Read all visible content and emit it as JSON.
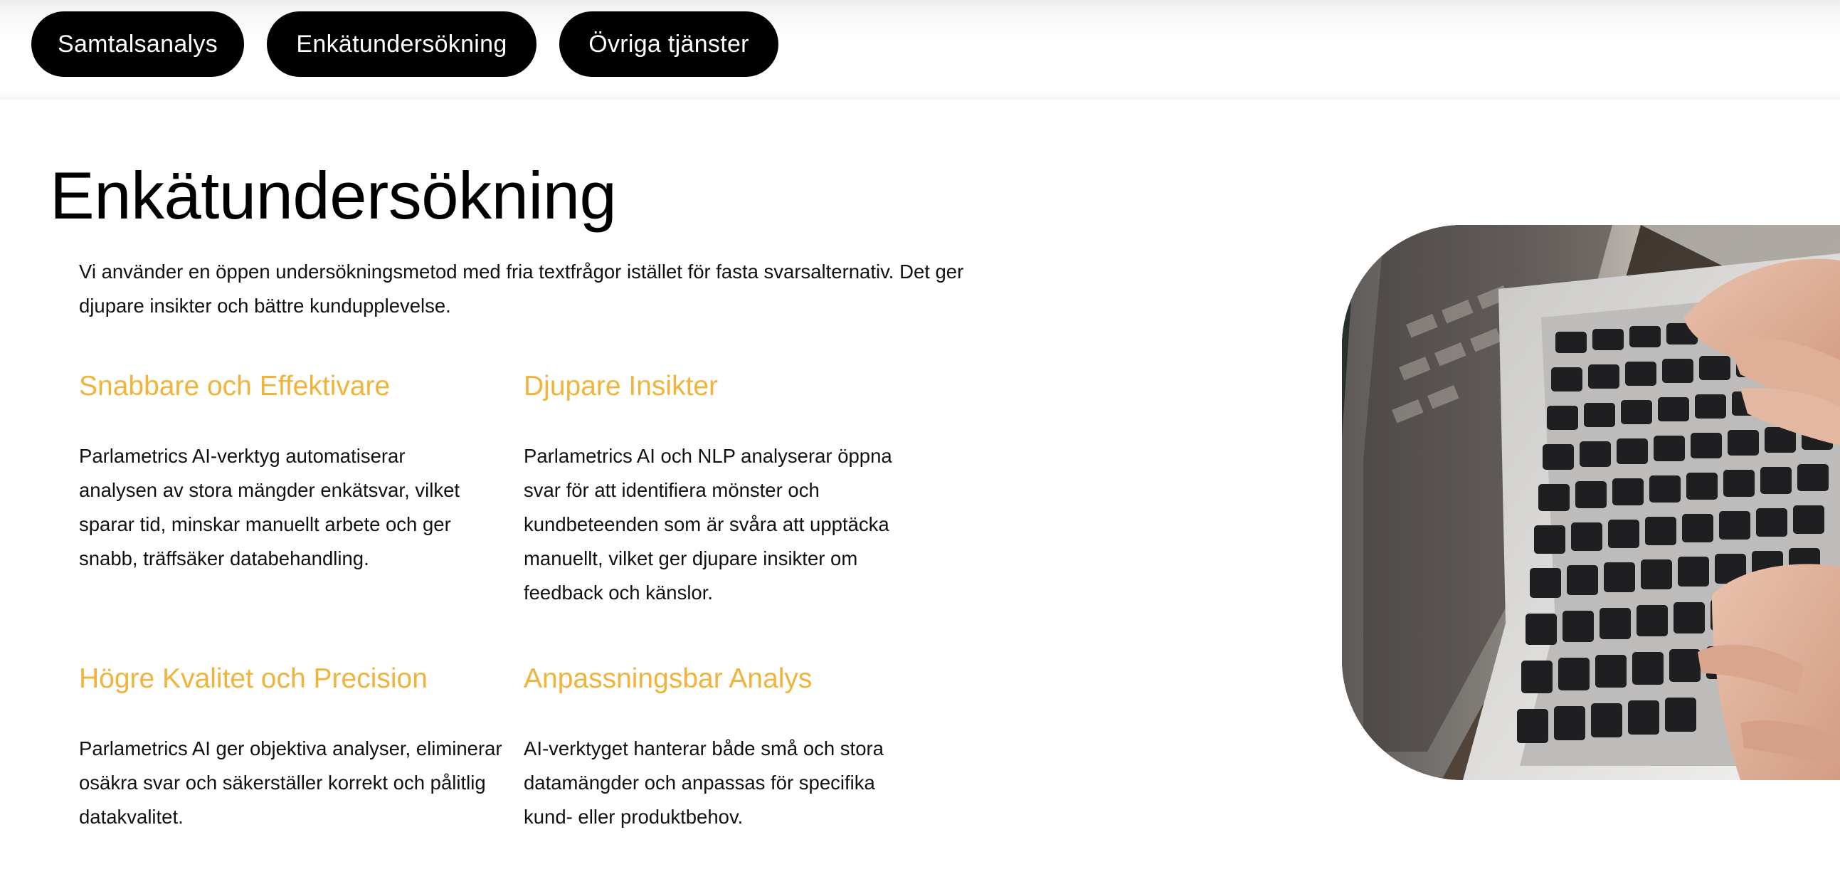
{
  "nav": {
    "items": [
      {
        "label": "Samtalsanalys"
      },
      {
        "label": "Enkätundersökning"
      },
      {
        "label": "Övriga tjänster"
      }
    ]
  },
  "page": {
    "title": "Enkätundersökning",
    "intro": "Vi använder en öppen undersökningsmetod med fria textfrågor istället för fasta svarsalternativ. Det ger djupare insikter och bättre kundupplevelse."
  },
  "features": [
    {
      "title": "Snabbare och Effektivare",
      "text": "Parlametrics AI-verktyg automatiserar analysen av stora mängder enkätsvar, vilket sparar tid, minskar manuellt arbete och ger snabb, träffsäker databehandling."
    },
    {
      "title": "Djupare Insikter",
      "text": "Parlametrics AI och NLP analyserar öppna svar för att identifiera mönster och kundbeteenden som är svåra att upptäcka manuellt, vilket ger djupare insikter om feedback och känslor."
    },
    {
      "title": "Högre Kvalitet och Precision",
      "text": "Parlametrics AI ger objektiva analyser, eliminerar osäkra svar och säkerställer korrekt och pålitlig datakvalitet."
    },
    {
      "title": "Anpassningsbar Analys",
      "text": "AI-verktyget hanterar både små och stora datamängder och anpassas för specifika kund- eller produktbehov."
    }
  ],
  "colors": {
    "accent": "#f0b43c",
    "pill_bg": "#000000",
    "pill_text": "#ffffff",
    "text": "#111111"
  },
  "media": {
    "hero_image_icon": "laptop-typing-photo"
  }
}
